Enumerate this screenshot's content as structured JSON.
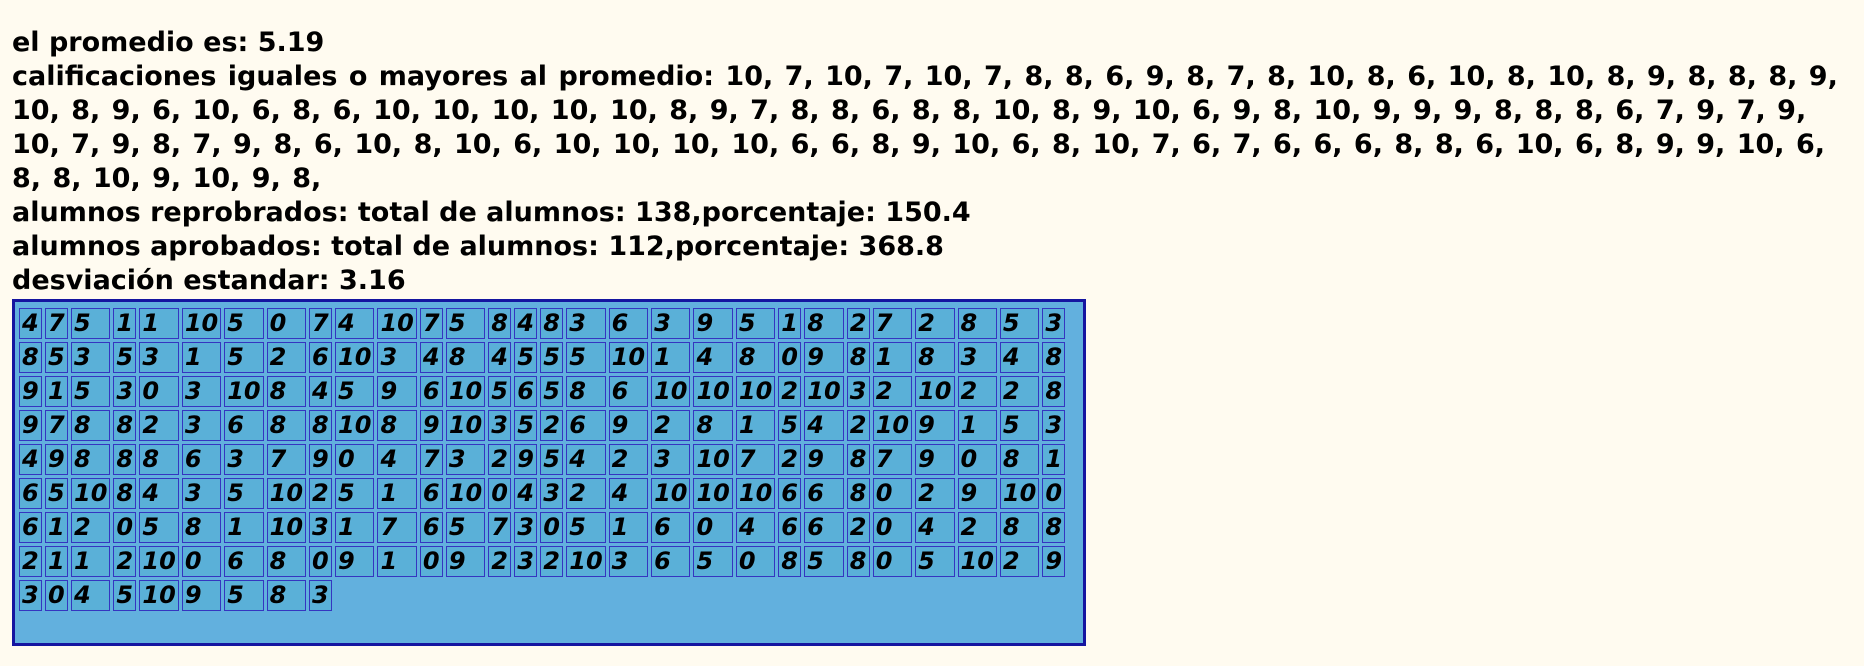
{
  "summary": {
    "average_line": "el promedio es: 5.19",
    "above_label": "calificaciones iguales o mayores al promedio:",
    "above_values": "10, 7, 10, 7, 10, 7, 8, 8, 6, 9, 8, 7, 8, 10, 8, 6, 10, 8, 10, 8, 9, 8, 8, 8, 9, 10, 8, 9, 6, 10, 6, 8, 6, 10, 10, 10, 10, 10, 8, 9, 7, 8, 8, 6, 8, 8, 10, 8, 9, 10, 6, 9, 8, 10, 9, 9, 9, 8, 8, 8, 6, 7, 9, 7, 9, 10, 7, 9, 8, 7, 9, 8, 6, 10, 8, 10, 6, 10, 10, 10, 10, 6, 6, 8, 9, 10, 6, 8, 10, 7, 6, 7, 6, 6, 6, 8, 8, 6, 10, 6, 8, 9, 9, 10, 6, 8, 8, 10, 9, 10, 9, 8,",
    "failed_line": "alumnos reprobrados: total de alumnos: 138,porcentaje: 150.4",
    "passed_line": "alumnos aprobados: total de alumnos: 112,porcentaje: 368.8",
    "stddev_line": "desviación estandar: 3.16"
  },
  "grid": {
    "rows": [
      [
        "4",
        "7",
        "5",
        "1",
        "1",
        "10",
        "5",
        "0",
        "7",
        "4",
        "10",
        "7",
        "5",
        "8",
        "4",
        "8",
        "3",
        "6",
        "3",
        "9",
        "5",
        "1",
        "8",
        "2",
        "7",
        "2",
        "8",
        "5",
        "3"
      ],
      [
        "8",
        "5",
        "3",
        "5",
        "3",
        "1",
        "5",
        "2",
        "6",
        "10",
        "3",
        "4",
        "8",
        "4",
        "5",
        "5",
        "5",
        "10",
        "1",
        "4",
        "8",
        "0",
        "9",
        "8",
        "1",
        "8",
        "3",
        "4",
        "8"
      ],
      [
        "9",
        "1",
        "5",
        "3",
        "0",
        "3",
        "10",
        "8",
        "4",
        "5",
        "9",
        "6",
        "10",
        "5",
        "6",
        "5",
        "8",
        "6",
        "10",
        "10",
        "10",
        "2",
        "10",
        "3",
        "2",
        "10",
        "2",
        "2",
        "8"
      ],
      [
        "9",
        "7",
        "8",
        "8",
        "2",
        "3",
        "6",
        "8",
        "8",
        "10",
        "8",
        "9",
        "10",
        "3",
        "5",
        "2",
        "6",
        "9",
        "2",
        "8",
        "1",
        "5",
        "4",
        "2",
        "10",
        "9",
        "1",
        "5",
        "3"
      ],
      [
        "4",
        "9",
        "8",
        "8",
        "8",
        "6",
        "3",
        "7",
        "9",
        "0",
        "4",
        "7",
        "3",
        "2",
        "9",
        "5",
        "4",
        "2",
        "3",
        "10",
        "7",
        "2",
        "9",
        "8",
        "7",
        "9",
        "0",
        "8",
        "1"
      ],
      [
        "6",
        "5",
        "10",
        "8",
        "4",
        "3",
        "5",
        "10",
        "2",
        "5",
        "1",
        "6",
        "10",
        "0",
        "4",
        "3",
        "2",
        "4",
        "10",
        "10",
        "10",
        "6",
        "6",
        "8",
        "0",
        "2",
        "9",
        "10",
        "0"
      ],
      [
        "6",
        "1",
        "2",
        "0",
        "5",
        "8",
        "1",
        "10",
        "3",
        "1",
        "7",
        "6",
        "5",
        "7",
        "3",
        "0",
        "5",
        "1",
        "6",
        "0",
        "4",
        "6",
        "6",
        "2",
        "0",
        "4",
        "2",
        "8",
        "8"
      ],
      [
        "2",
        "1",
        "1",
        "2",
        "10",
        "0",
        "6",
        "8",
        "0",
        "9",
        "1",
        "0",
        "9",
        "2",
        "3",
        "2",
        "10",
        "3",
        "6",
        "5",
        "0",
        "8",
        "5",
        "8",
        "0",
        "5",
        "10",
        "2",
        "9"
      ],
      [
        "3",
        "0",
        "4",
        "5",
        "10",
        "9",
        "5",
        "8",
        "3"
      ]
    ]
  }
}
